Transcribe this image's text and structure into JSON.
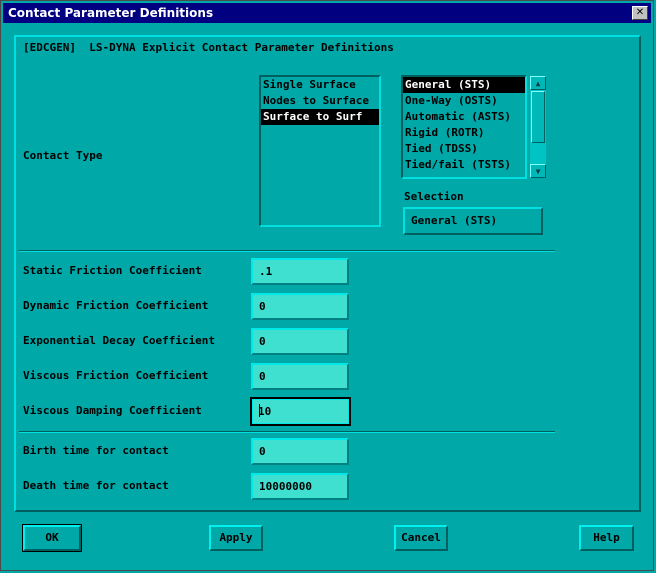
{
  "window": {
    "title": "Contact Parameter Definitions",
    "close_glyph": "✕"
  },
  "header": "[EDCGEN]  LS-DYNA Explicit Contact Parameter Definitions",
  "contact_type": {
    "label": "Contact Type",
    "category_list": {
      "items": [
        "Single Surface",
        "Nodes to Surface",
        "Surface to Surf"
      ],
      "selected_index": 2
    },
    "type_list": {
      "items": [
        "General (STS)",
        "One-Way (OSTS)",
        "Automatic (ASTS)",
        "Rigid (ROTR)",
        "Tied (TDSS)",
        "Tied/fail (TSTS)"
      ],
      "selected_index": 0
    },
    "selection_label": "Selection",
    "selection_value": "General (STS)"
  },
  "friction": {
    "static": {
      "label": "Static Friction Coefficient",
      "value": ".1"
    },
    "dynamic": {
      "label": "Dynamic Friction Coefficient",
      "value": "0"
    },
    "exponential": {
      "label": "Exponential Decay Coefficient",
      "value": "0"
    },
    "viscous_friction": {
      "label": "Viscous Friction Coefficient",
      "value": "0"
    },
    "viscous_damping": {
      "label": "Viscous Damping Coefficient",
      "value": "10"
    }
  },
  "time": {
    "birth": {
      "label": "Birth time for contact",
      "value": "0"
    },
    "death": {
      "label": "Death time for contact",
      "value": "10000000"
    }
  },
  "buttons": {
    "ok": "OK",
    "apply": "Apply",
    "cancel": "Cancel",
    "help": "Help"
  },
  "colors": {
    "background": "#00a8a8",
    "titlebar": "#000080",
    "field": "#40e0d0"
  }
}
